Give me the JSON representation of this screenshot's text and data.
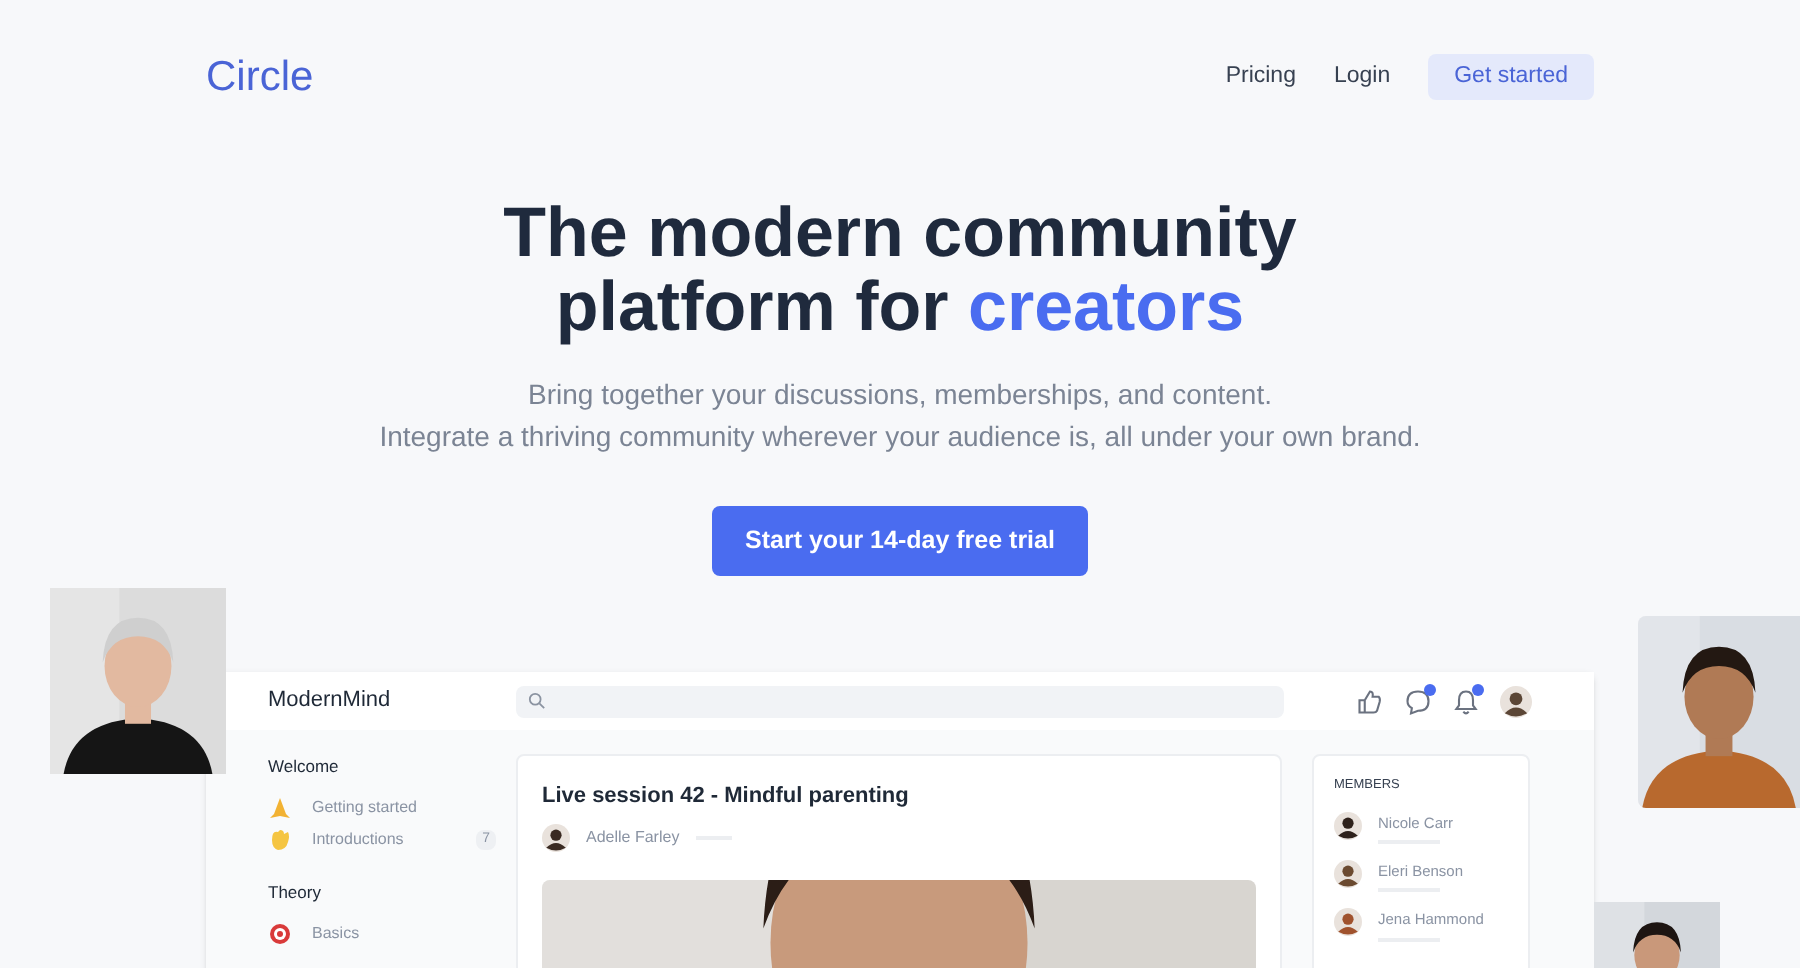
{
  "nav": {
    "logo": "Circle",
    "links": [
      "Pricing",
      "Login"
    ],
    "cta": "Get started"
  },
  "hero": {
    "title_line1": "The modern community",
    "title_line2_start": "platform for",
    "title_highlight": "creators",
    "subtitle": [
      "Bring together your discussions, memberships, and content.",
      "Integrate a thriving community wherever your audience is, all under your own brand."
    ],
    "cta": "Start your 14-day free trial"
  },
  "app": {
    "brand": "ModernMind",
    "header_icons": [
      {
        "kind": "likes",
        "badge": false
      },
      {
        "kind": "chat",
        "badge": true
      },
      {
        "kind": "bell",
        "badge": true
      }
    ],
    "sidebar": [
      {
        "title": "Welcome",
        "items": [
          {
            "label": "Getting started"
          },
          {
            "label": "Introductions",
            "count": "7"
          }
        ]
      },
      {
        "title": "Theory",
        "items": [
          {
            "label": "Basics"
          }
        ]
      }
    ],
    "post": {
      "title": "Live session 42 - Mindful parenting",
      "author": "Adelle Farley"
    },
    "members": {
      "heading": "MEMBERS",
      "items": [
        "Nicole Carr",
        "Eleri Benson",
        "Jena Hammond"
      ]
    }
  }
}
